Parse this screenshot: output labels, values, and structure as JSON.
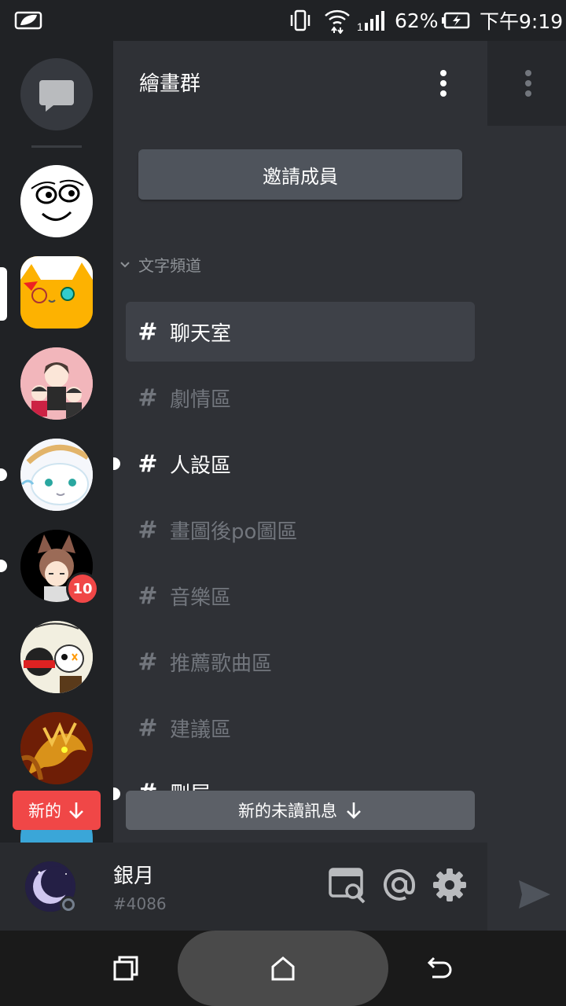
{
  "status_bar": {
    "battery_percent": "62%",
    "time": "下午9:19",
    "icons": [
      "notification-leaf-icon",
      "vibrate-icon",
      "wifi-icon",
      "signal-icon",
      "battery-icon"
    ]
  },
  "server": {
    "name": "繪畫群",
    "invite_label": "邀請成員",
    "category_label": "文字頻道",
    "channels": [
      {
        "name": "聊天室",
        "state": "active"
      },
      {
        "name": "劇情區",
        "state": "read"
      },
      {
        "name": "人設區",
        "state": "unread"
      },
      {
        "name": "畫圖後po圖區",
        "state": "read"
      },
      {
        "name": "音樂區",
        "state": "read"
      },
      {
        "name": "推薦歌曲區",
        "state": "read"
      },
      {
        "name": "建議區",
        "state": "read"
      },
      {
        "name": "刪屋",
        "state": "unread"
      }
    ],
    "unread_bar_label": "新的未讀訊息",
    "new_badge_label": "新的"
  },
  "server_rail": {
    "mention_badge": "10"
  },
  "user": {
    "name": "銀月",
    "tag": "#4086"
  },
  "colors": {
    "rail_bg": "#202225",
    "panel_bg": "#2f3136",
    "active_channel_bg": "#3e4148",
    "accent_red": "#f04747",
    "muted_text": "#72767d"
  }
}
